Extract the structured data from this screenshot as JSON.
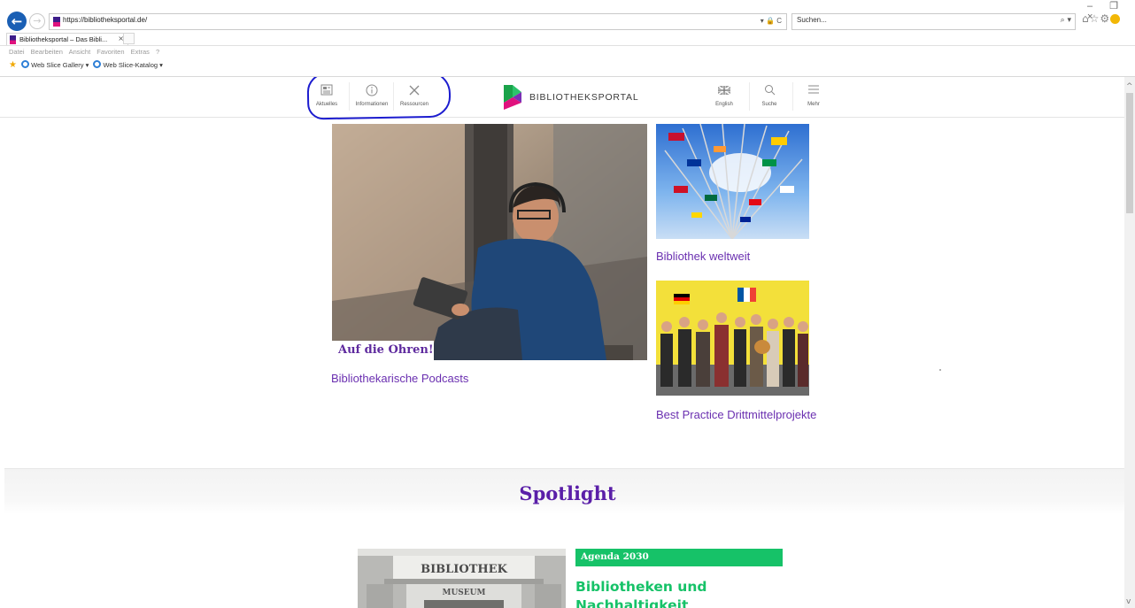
{
  "browser": {
    "url": "https://bibliotheksportal.de/",
    "search_placeholder": "Suchen...",
    "tab_title": "Bibliotheksportal – Das Bibli...",
    "tab_close": "×",
    "address_icons": "▾ 🔒 C",
    "menu": [
      "Datei",
      "Bearbeiten",
      "Ansicht",
      "Favoriten",
      "Extras",
      "?"
    ],
    "favorites": {
      "gallery": "Web Slice Gallery ▾",
      "catalog": "Web Slice-Katalog ▾"
    },
    "window_controls": "– ❐ ×"
  },
  "header": {
    "nav_left": [
      {
        "label": "Aktuelles",
        "icon": "newspaper-icon"
      },
      {
        "label": "Informationen",
        "icon": "info-icon"
      },
      {
        "label": "Ressourcen",
        "icon": "tools-icon"
      }
    ],
    "logo_text": "BIBLIOTHEKSPORTAL",
    "nav_right": [
      {
        "label": "English",
        "icon": "uk-flag-icon"
      },
      {
        "label": "Suche",
        "icon": "search-icon"
      },
      {
        "label": "Mehr",
        "icon": "hamburger-icon"
      }
    ]
  },
  "hero": {
    "tag": "Auf die Ohren!",
    "caption": "Bibliothekarische Podcasts"
  },
  "side_teasers": [
    {
      "caption": "Bibliothek weltweit"
    },
    {
      "caption": "Best Practice Drittmittelprojekte"
    }
  ],
  "spotlight": {
    "title": "Spotlight",
    "tag": "Agenda 2030",
    "headline": "Bibliotheken und Nachhaltigkeit",
    "image_text": [
      "BIBLIOTHEK",
      "MUSEUM"
    ]
  },
  "colors": {
    "brand_purple": "#6a2fb0",
    "spotlight_green": "#16c268",
    "annotation_blue": "#1c1ccf"
  }
}
